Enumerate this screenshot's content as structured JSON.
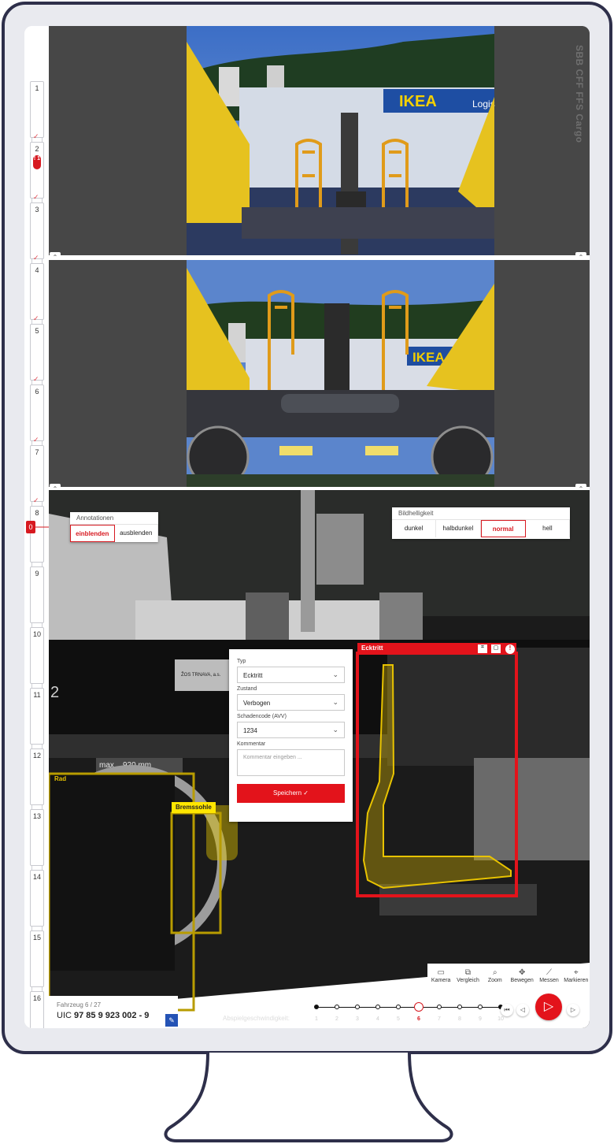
{
  "timeline": {
    "items": [
      {
        "num": "1",
        "checked": true
      },
      {
        "num": "2",
        "checked": true,
        "badge": "! 1"
      },
      {
        "num": "3",
        "checked": true
      },
      {
        "num": "4",
        "checked": true
      },
      {
        "num": "5",
        "checked": true
      },
      {
        "num": "6",
        "checked": true
      },
      {
        "num": "7",
        "checked": true
      },
      {
        "num": "8",
        "checked": false
      },
      {
        "num": "9",
        "checked": false
      },
      {
        "num": "10",
        "checked": false
      },
      {
        "num": "11",
        "checked": false
      },
      {
        "num": "12",
        "checked": false
      },
      {
        "num": "13",
        "checked": false
      },
      {
        "num": "14",
        "checked": false
      },
      {
        "num": "15",
        "checked": false
      },
      {
        "num": "16",
        "checked": false
      }
    ],
    "current_marker": "0"
  },
  "brand": "SBB CFF FFS Cargo",
  "photo_signs": {
    "ikea": "IKEA",
    "ikea_sub": "Logis",
    "plate": "ŽOS TRNAVA, a.s.",
    "max_label": "max",
    "max_value": "920 mm",
    "wagon_no": "2"
  },
  "annotations": {
    "title": "Annotationen",
    "options": [
      "einblenden",
      "ausblenden"
    ],
    "active": "einblenden"
  },
  "brightness": {
    "title": "Bildhelligkeit",
    "options": [
      "dunkel",
      "halbdunkel",
      "normal",
      "hell"
    ],
    "active": "normal"
  },
  "form": {
    "typ_label": "Typ",
    "typ_value": "Ecktritt",
    "zustand_label": "Zustand",
    "zustand_value": "Verbogen",
    "schaden_label": "Schadencode (AVV)",
    "schaden_value": "1234",
    "kommentar_label": "Kommentar",
    "kommentar_placeholder": "Kommentar eingeben ...",
    "save_label": "Speichern ✓"
  },
  "labels": {
    "ecktritt": "Ecktritt",
    "rad": "Rad",
    "bremssohle": "Bremssohle"
  },
  "tools": [
    {
      "label": "Kamera",
      "icon": "camera-icon",
      "glyph": "▭"
    },
    {
      "label": "Vergleich",
      "icon": "compare-icon",
      "glyph": "⧉"
    },
    {
      "label": "Zoom",
      "icon": "zoom-icon",
      "glyph": "⌕"
    },
    {
      "label": "Bewegen",
      "icon": "move-icon",
      "glyph": "✥"
    },
    {
      "label": "Messen",
      "icon": "measure-icon",
      "glyph": "⟋"
    },
    {
      "label": "Markieren",
      "icon": "tag-icon",
      "glyph": "⌖"
    }
  ],
  "vehicle": {
    "count_text": "Fahrzeug 6 / 27",
    "uic_prefix": "UIC",
    "uic_number": "97 85 9 923 002 - 9"
  },
  "speed": {
    "label": "Abspielgeschwindigkeit:",
    "values": [
      "1",
      "2",
      "3",
      "4",
      "5",
      "6",
      "7",
      "8",
      "9",
      "10"
    ],
    "current": 6
  },
  "colors": {
    "accent": "#d71920",
    "annotation_yellow": "#e8c300",
    "selection_red": "#e3131b",
    "monitor": "#2e2f4a"
  }
}
